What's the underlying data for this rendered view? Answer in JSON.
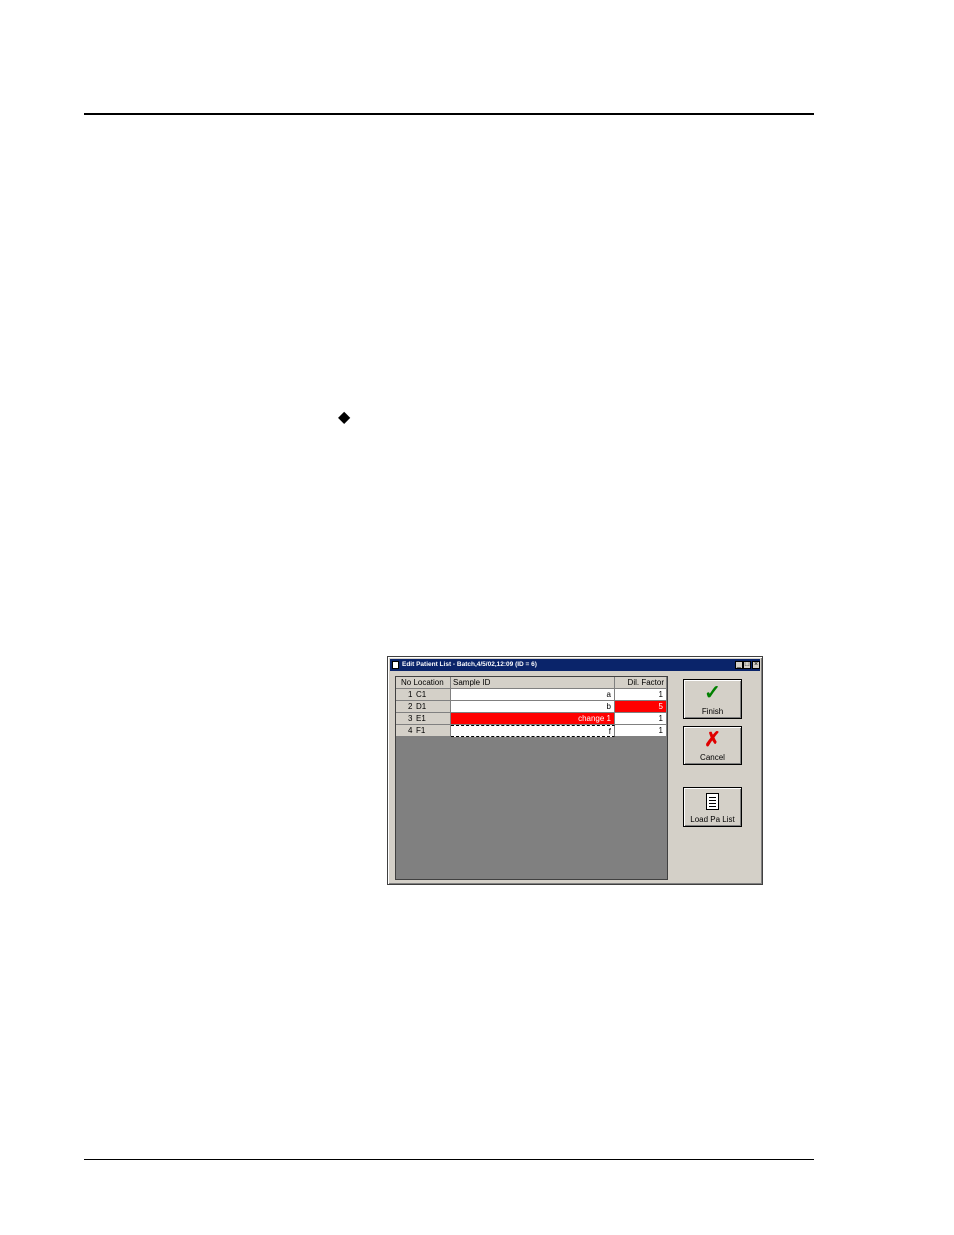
{
  "page": {
    "bullet_symbol": "◆"
  },
  "dialog": {
    "title": "Edit Patient List - Batch,4/5/02,12:09 (ID = 6)",
    "titlebar_buttons": {
      "minimize": "_",
      "maximize": "□",
      "close": "×"
    },
    "grid": {
      "headers": {
        "no_location": "No Location",
        "sample_id": "Sample ID",
        "dil_factor": "Dil. Factor"
      },
      "rows": [
        {
          "no": "1",
          "location": "C1",
          "sample_id": "a",
          "dil_factor": "1"
        },
        {
          "no": "2",
          "location": "D1",
          "sample_id": "b",
          "dil_factor": "5"
        },
        {
          "no": "3",
          "location": "E1",
          "sample_id": "change 1",
          "dil_factor": "1"
        },
        {
          "no": "4",
          "location": "F1",
          "sample_id": "f",
          "dil_factor": "1"
        }
      ]
    },
    "buttons": {
      "finish": "Finish",
      "cancel": "Cancel",
      "load": "Load Pa List"
    },
    "icons": {
      "finish": "checkmark-icon",
      "cancel": "x-icon",
      "load": "document-icon"
    },
    "colors": {
      "highlight": "#ff0000",
      "titlebar": "#0a246a",
      "check": "#008000",
      "cross": "#e00000"
    }
  }
}
